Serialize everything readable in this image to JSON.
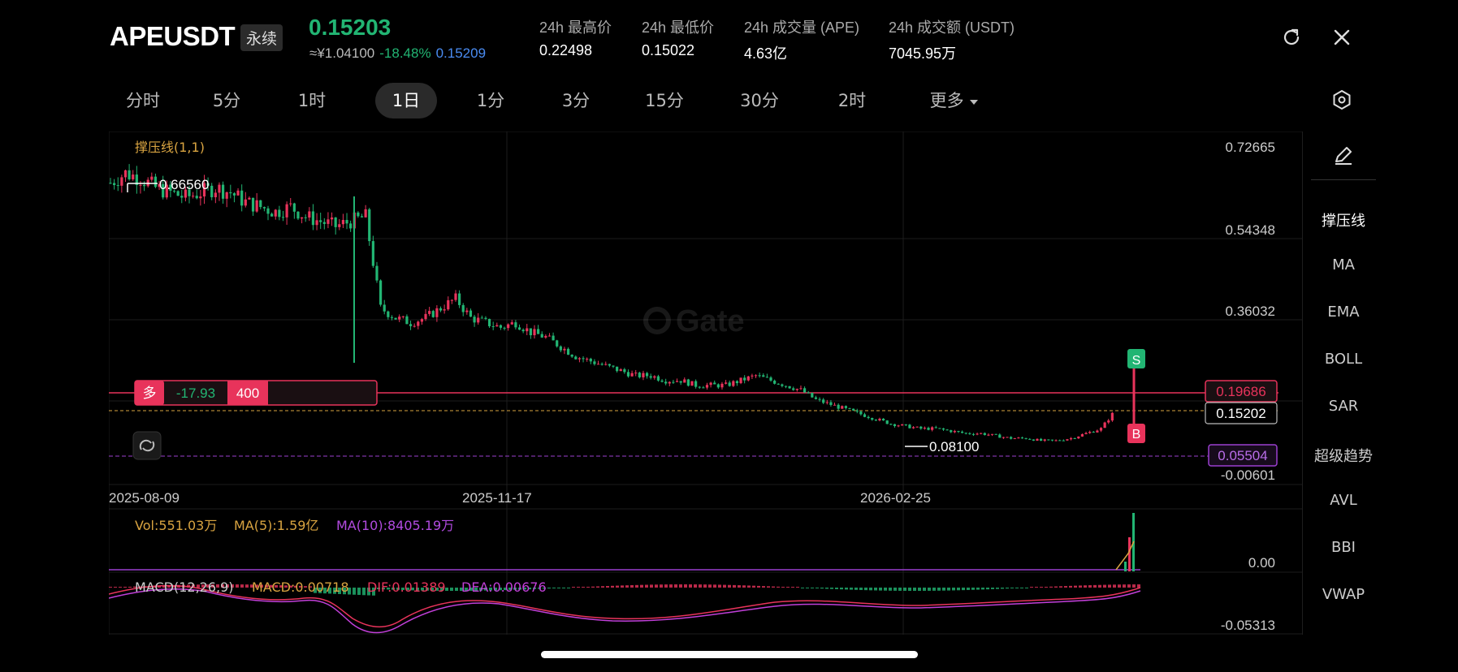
{
  "header": {
    "symbol": "APEUSDT",
    "contract_type": "永续",
    "last_price": "0.15203",
    "cny_price": "≈¥1.04100",
    "change_pct": "-18.48%",
    "mark_price": "0.15209",
    "stats": [
      {
        "label": "24h 最高价",
        "value": "0.22498"
      },
      {
        "label": "24h 最低价",
        "value": "0.15022"
      },
      {
        "label": "24h 成交量 (APE)",
        "value": "4.63亿"
      },
      {
        "label": "24h 成交额 (USDT)",
        "value": "7045.95万"
      }
    ],
    "refresh_icon": "refresh-icon",
    "close_icon": "close-icon"
  },
  "tabs": {
    "items": [
      "分时",
      "5分",
      "1时",
      "1日",
      "1分",
      "3分",
      "15分",
      "30分",
      "2时",
      "更多"
    ],
    "active": "1日",
    "settings_icon": "hex-settings-icon"
  },
  "sidebar": {
    "edit_icon": "pencil-icon",
    "items": [
      "撑压线",
      "MA",
      "EMA",
      "BOLL",
      "SAR",
      "超级趋势",
      "AVL",
      "BBI",
      "VWAP"
    ],
    "active": "撑压线"
  },
  "chart": {
    "indicator_label": "撑压线(1,1)",
    "watermark": "Gate",
    "y_ticks": [
      "0.72665",
      "0.54348",
      "0.36032",
      "-0.00601"
    ],
    "x_ticks": [
      "2025-08-09",
      "2025-11-17",
      "2026-02-25"
    ],
    "high_label": "0.66560",
    "low_label": "0.08100",
    "position": {
      "side": "多",
      "pnl": "-17.93",
      "qty": "400"
    },
    "price_tags": {
      "entry": "0.19686",
      "current": "0.15202",
      "liq": "0.05504"
    },
    "marker_s": "S",
    "marker_b": "B",
    "colors": {
      "up": "#e8335b",
      "down": "#22b573",
      "grid": "#1c1c1c",
      "entry_line": "#e8335b",
      "liq_line": "#9b3fd0",
      "current_line": "#d9a441"
    }
  },
  "volume": {
    "vol_label": "Vol:551.03万",
    "ma5_label": "MA(5):1.59亿",
    "ma10_label": "MA(10):8405.19万",
    "y_tick": "0.00"
  },
  "macd": {
    "macd_label": "MACD(12,26,9)",
    "macd_val": "MACD:0.00718",
    "dif_val": "DIF:0.01389",
    "dea_val": "DEA:0.00676",
    "y_tick": "-0.05313"
  },
  "chart_data": {
    "type": "candlestick",
    "x_ticks": [
      "2025-08-09",
      "2025-11-17",
      "2026-02-25"
    ],
    "ylim": [
      -0.00601,
      0.72665
    ],
    "approx_close_series": [
      0.62,
      0.64,
      0.63,
      0.61,
      0.6,
      0.59,
      0.6,
      0.61,
      0.6,
      0.58,
      0.57,
      0.56,
      0.57,
      0.55,
      0.54,
      0.53,
      0.54,
      0.55,
      0.36,
      0.34,
      0.33,
      0.34,
      0.36,
      0.38,
      0.34,
      0.33,
      0.32,
      0.33,
      0.31,
      0.3,
      0.28,
      0.26,
      0.25,
      0.24,
      0.23,
      0.22,
      0.22,
      0.21,
      0.21,
      0.2,
      0.2,
      0.2,
      0.21,
      0.22,
      0.21,
      0.2,
      0.19,
      0.17,
      0.16,
      0.15,
      0.14,
      0.13,
      0.12,
      0.115,
      0.11,
      0.11,
      0.105,
      0.1,
      0.1,
      0.095,
      0.09,
      0.09,
      0.085,
      0.085,
      0.09,
      0.1,
      0.11,
      0.15
    ]
  }
}
